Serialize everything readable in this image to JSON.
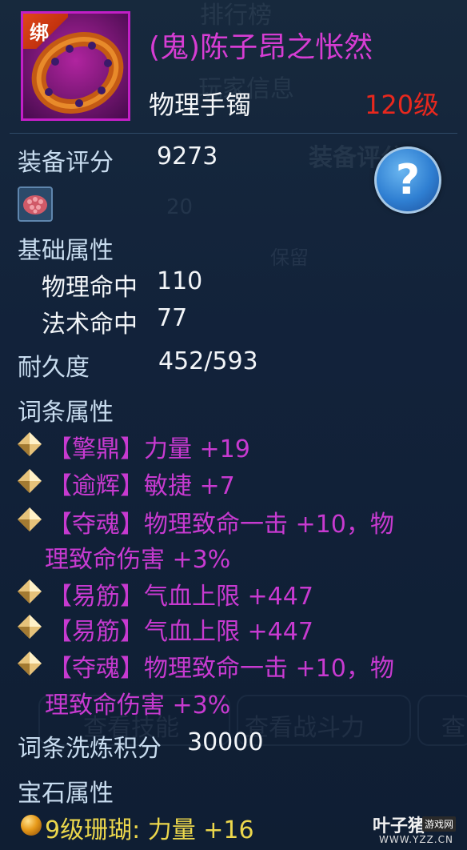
{
  "item": {
    "bind_label": "绑",
    "name": "(鬼)陈子昂之怅然",
    "type": "物理手镯",
    "level": "120级"
  },
  "score": {
    "label": "装备评分",
    "value": "9273"
  },
  "help": {
    "label": "?"
  },
  "base": {
    "heading": "基础属性",
    "stats": [
      {
        "label": "物理命中",
        "value": "110"
      },
      {
        "label": "法术命中",
        "value": "77"
      }
    ]
  },
  "durability": {
    "label": "耐久度",
    "value": "452/593"
  },
  "affix": {
    "heading": "词条属性",
    "entries": [
      {
        "line1": "【擎鼎】力量 +19",
        "line2": ""
      },
      {
        "line1": "【逾辉】敏捷 +7",
        "line2": ""
      },
      {
        "line1": "【夺魂】物理致命一击 +10，物",
        "line2": "理致命伤害 +3%"
      },
      {
        "line1": "【易筋】气血上限 +447",
        "line2": ""
      },
      {
        "line1": "【易筋】气血上限 +447",
        "line2": ""
      },
      {
        "line1": "【夺魂】物理致命一击 +10，物",
        "line2": "理致命伤害 +3%"
      }
    ]
  },
  "refine": {
    "label": "词条洗炼积分",
    "value": "30000"
  },
  "gem": {
    "heading": "宝石属性",
    "entry": "9级珊瑚: 力量 +16"
  },
  "watermark": {
    "brand": "叶子猪",
    "tag": "游戏网",
    "url": "WWW.YZZ.CN"
  },
  "background_text": {
    "tab1": "排行榜",
    "tab2": "玩家信息",
    "panel_title": "装备评分",
    "level_badge": "20",
    "slot_label": "保留",
    "btn1": "查看技能",
    "btn2": "查看战斗力",
    "btn3": "查"
  },
  "colors": {
    "name_purple": "#d63dd3",
    "affix_purple": "#c73ad0",
    "level_red": "#e8281e",
    "gem_gold": "#ecd74c"
  },
  "icons": [
    "bracelet-icon",
    "bind-tag",
    "help-icon",
    "coral-gem-icon",
    "diamond-bullet-icon",
    "gem-orb-icon"
  ]
}
